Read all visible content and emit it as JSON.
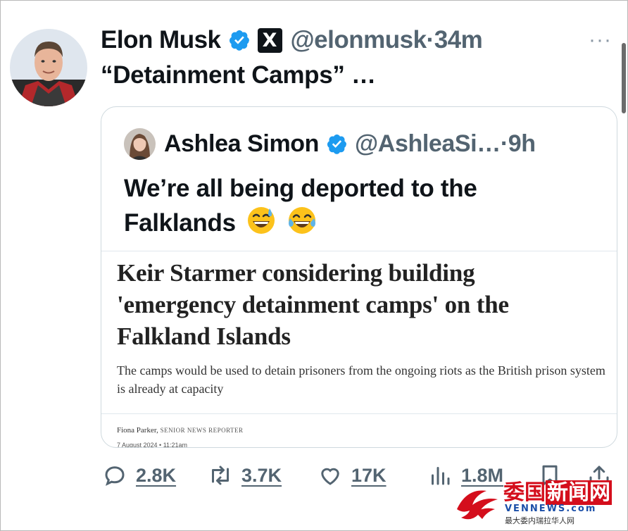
{
  "tweet": {
    "author_name": "Elon Musk",
    "handle": "@elonmusk",
    "separator": "·",
    "time": "34m",
    "text": "“Detainment Camps” …",
    "more_label": "···",
    "x_badge": "X"
  },
  "quoted_tweet": {
    "author_name": "Ashlea Simon",
    "handle": "@AshleaSi…",
    "separator": "·",
    "time": "9h",
    "text": "We’re all being deported to the Falklands",
    "emojis": [
      "grinning-face-with-sweat",
      "face-with-tears-of-joy"
    ]
  },
  "article": {
    "headline": "Keir Starmer considering building 'emergency detainment camps' on the Falkland Islands",
    "standfirst": "The camps would be used to detain prisoners from the ongoing riots as the British prison system is already at capacity",
    "author": "Fiona Parker,",
    "author_role": "SENIOR NEWS REPORTER",
    "date": "7 August 2024 • 11:21am"
  },
  "actions": {
    "replies": "2.8K",
    "reposts": "3.7K",
    "likes": "17K",
    "views": "1.8M"
  },
  "watermark": {
    "title_part1": "委国",
    "title_part2": "新闻网",
    "url": "VENNEWS.com",
    "subtitle": "最大委内瑞拉华人网"
  },
  "colors": {
    "verified_blue": "#1d9bf0",
    "secondary_text": "#536471",
    "border": "#cfd9de",
    "watermark_red": "#d40e1c"
  }
}
